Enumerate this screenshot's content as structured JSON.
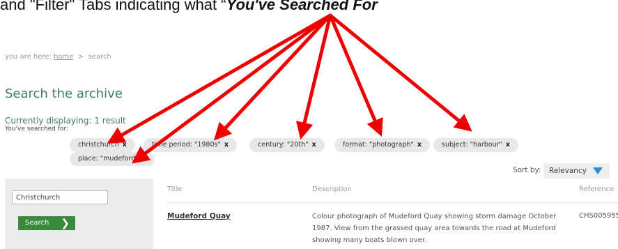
{
  "caption": {
    "prefix": "and \"Filter\" Tabs indicating what “",
    "emphasis": "You've Searched For"
  },
  "breadcrumb": {
    "prefix": "you are here:",
    "home": "home",
    "sep": ">",
    "current": "search"
  },
  "page_title": "Search the archive",
  "displaying": "Currently displaying: 1 result",
  "searched_for": "You've searched for:",
  "filters": [
    {
      "label": "christchurch",
      "remove": "x"
    },
    {
      "label": "time period: \"1980s\"",
      "remove": "x"
    },
    {
      "label": "century: \"20th\"",
      "remove": "x"
    },
    {
      "label": "format: \"photograph\"",
      "remove": "x"
    },
    {
      "label": "subject: \"harbour\"",
      "remove": "x"
    },
    {
      "label": "place: \"mudeford\"",
      "remove": "x"
    }
  ],
  "sort": {
    "label": "Sort by:",
    "value": "Relevancy"
  },
  "search": {
    "value": "Christchurch",
    "button": "Search"
  },
  "table": {
    "headers": {
      "title": "Title",
      "description": "Description",
      "reference": "Reference"
    },
    "rows": [
      {
        "title": "Mudeford Quay",
        "description": "Colour photograph of Mudeford Quay showing storm damage October 1987. View from the grassed quay area towards the road at Mudeford showing many boats blown over.",
        "reference": "CHS005955"
      }
    ]
  },
  "colors": {
    "accent_green": "#3e7d5a",
    "button_green": "#3b8a3c",
    "arrow_red": "#ee0000",
    "sort_arrow": "#2a8fd6"
  }
}
